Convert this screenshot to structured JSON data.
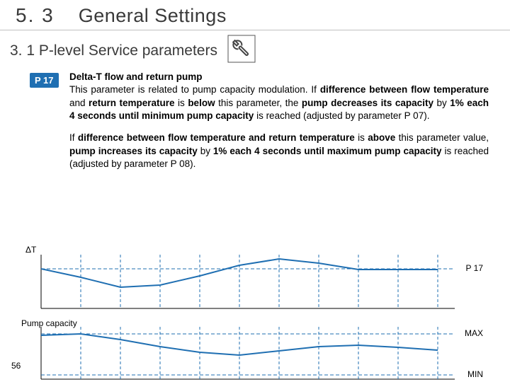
{
  "header": {
    "section_number": "5. 3",
    "section_title": "General Settings"
  },
  "subheader": {
    "text": "3. 1 P-level Service parameters"
  },
  "badge": {
    "label": "P 17"
  },
  "paragraphs": {
    "title": "Delta-T flow and return pump",
    "p1_a": "This parameter is related to pump capacity modulation. If ",
    "p1_b": "difference between flow temperature",
    "p1_c": " and ",
    "p1_d": "return temperature",
    "p1_e": " is ",
    "p1_f": "below",
    "p1_g": " this parameter, the ",
    "p1_h": "pump decreases its capacity",
    "p1_i": " by ",
    "p1_j": "1% each 4 seconds until minimum pump capacity",
    "p1_k": " is reached (adjusted by parameter P 07).",
    "p2_a": "If ",
    "p2_b": "difference between flow temperature and return temperature",
    "p2_c": " is ",
    "p2_d": "above",
    "p2_e": " this parameter value, ",
    "p2_f": "pump increases its capacity",
    "p2_g": " by ",
    "p2_h": "1% each 4 seconds until maximum pump capacity",
    "p2_i": " is reached (adjusted by parameter P 08)."
  },
  "chart1": {
    "y_label": "ΔT",
    "right_label": "P 17"
  },
  "chart2": {
    "y_label": "Pump capacity",
    "right_top": "MAX",
    "right_bottom": "MIN"
  },
  "page_number": "56",
  "chart_data": [
    {
      "type": "line",
      "title": "ΔT",
      "x": [
        0,
        1,
        2,
        3,
        4,
        5,
        6,
        7,
        8,
        9,
        10
      ],
      "series": [
        {
          "name": "ΔT",
          "values": [
            20,
            16,
            11,
            12,
            17,
            22,
            25,
            23,
            20,
            20,
            20
          ]
        },
        {
          "name": "P 17 threshold",
          "values": [
            20,
            20,
            20,
            20,
            20,
            20,
            20,
            20,
            20,
            20,
            20
          ]
        }
      ],
      "ylim": [
        0,
        30
      ],
      "xlabel": "",
      "ylabel": "ΔT"
    },
    {
      "type": "line",
      "title": "Pump capacity",
      "x": [
        0,
        1,
        2,
        3,
        4,
        5,
        6,
        7,
        8,
        9,
        10
      ],
      "series": [
        {
          "name": "Pump capacity",
          "values": [
            90,
            92,
            82,
            70,
            60,
            55,
            62,
            70,
            72,
            68,
            63
          ]
        },
        {
          "name": "MAX",
          "values": [
            92,
            92,
            92,
            92,
            92,
            92,
            92,
            92,
            92,
            92,
            92
          ]
        },
        {
          "name": "MIN",
          "values": [
            10,
            10,
            10,
            10,
            10,
            10,
            10,
            10,
            10,
            10,
            10
          ]
        }
      ],
      "ylim": [
        0,
        100
      ],
      "xlabel": "",
      "ylabel": "Pump capacity"
    }
  ]
}
